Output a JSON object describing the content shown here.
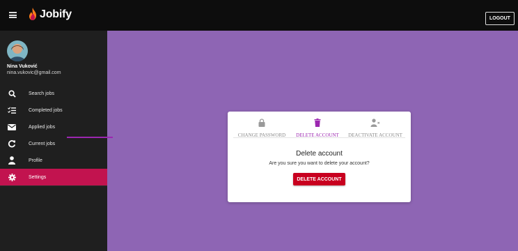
{
  "topbar": {
    "brand": "Jobify",
    "logout_label": "LOGOUT"
  },
  "user": {
    "name": "Nina Vuković",
    "email": "nina.vukovic@gmail.com"
  },
  "sidebar": {
    "items": [
      {
        "label": "Search jobs",
        "icon": "search-icon"
      },
      {
        "label": "Completed jobs",
        "icon": "checklist-icon"
      },
      {
        "label": "Applied jobs",
        "icon": "envelope-icon"
      },
      {
        "label": "Current jobs",
        "icon": "refresh-icon"
      },
      {
        "label": "Profile",
        "icon": "person-icon"
      },
      {
        "label": "Settings",
        "icon": "gear-icon",
        "active": true
      }
    ]
  },
  "settings": {
    "tabs": [
      {
        "label": "CHANGE PASSWORD",
        "icon": "lock-icon"
      },
      {
        "label": "DELETE ACCOUNT",
        "icon": "trash-icon",
        "active": true
      },
      {
        "label": "DEACTIVATE ACCOUNT",
        "icon": "person-off-icon"
      }
    ],
    "title": "Delete account",
    "message": "Are you sure you want to delete your account?",
    "button_label": "DELETE ACCOUNT"
  },
  "colors": {
    "accent": "#9c27b0",
    "active_nav": "#c2134f",
    "danger": "#c8001f",
    "background": "#8e65b4"
  }
}
